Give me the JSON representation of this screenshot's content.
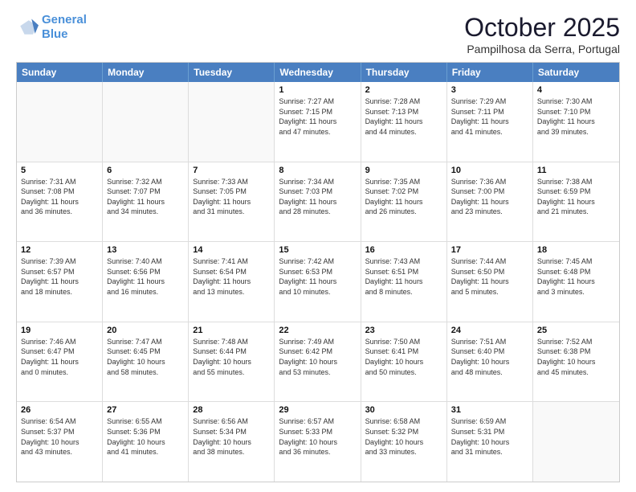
{
  "logo": {
    "line1": "General",
    "line2": "Blue"
  },
  "header": {
    "month": "October 2025",
    "location": "Pampilhosa da Serra, Portugal"
  },
  "weekdays": [
    "Sunday",
    "Monday",
    "Tuesday",
    "Wednesday",
    "Thursday",
    "Friday",
    "Saturday"
  ],
  "rows": [
    [
      {
        "day": "",
        "info": ""
      },
      {
        "day": "",
        "info": ""
      },
      {
        "day": "",
        "info": ""
      },
      {
        "day": "1",
        "info": "Sunrise: 7:27 AM\nSunset: 7:15 PM\nDaylight: 11 hours\nand 47 minutes."
      },
      {
        "day": "2",
        "info": "Sunrise: 7:28 AM\nSunset: 7:13 PM\nDaylight: 11 hours\nand 44 minutes."
      },
      {
        "day": "3",
        "info": "Sunrise: 7:29 AM\nSunset: 7:11 PM\nDaylight: 11 hours\nand 41 minutes."
      },
      {
        "day": "4",
        "info": "Sunrise: 7:30 AM\nSunset: 7:10 PM\nDaylight: 11 hours\nand 39 minutes."
      }
    ],
    [
      {
        "day": "5",
        "info": "Sunrise: 7:31 AM\nSunset: 7:08 PM\nDaylight: 11 hours\nand 36 minutes."
      },
      {
        "day": "6",
        "info": "Sunrise: 7:32 AM\nSunset: 7:07 PM\nDaylight: 11 hours\nand 34 minutes."
      },
      {
        "day": "7",
        "info": "Sunrise: 7:33 AM\nSunset: 7:05 PM\nDaylight: 11 hours\nand 31 minutes."
      },
      {
        "day": "8",
        "info": "Sunrise: 7:34 AM\nSunset: 7:03 PM\nDaylight: 11 hours\nand 28 minutes."
      },
      {
        "day": "9",
        "info": "Sunrise: 7:35 AM\nSunset: 7:02 PM\nDaylight: 11 hours\nand 26 minutes."
      },
      {
        "day": "10",
        "info": "Sunrise: 7:36 AM\nSunset: 7:00 PM\nDaylight: 11 hours\nand 23 minutes."
      },
      {
        "day": "11",
        "info": "Sunrise: 7:38 AM\nSunset: 6:59 PM\nDaylight: 11 hours\nand 21 minutes."
      }
    ],
    [
      {
        "day": "12",
        "info": "Sunrise: 7:39 AM\nSunset: 6:57 PM\nDaylight: 11 hours\nand 18 minutes."
      },
      {
        "day": "13",
        "info": "Sunrise: 7:40 AM\nSunset: 6:56 PM\nDaylight: 11 hours\nand 16 minutes."
      },
      {
        "day": "14",
        "info": "Sunrise: 7:41 AM\nSunset: 6:54 PM\nDaylight: 11 hours\nand 13 minutes."
      },
      {
        "day": "15",
        "info": "Sunrise: 7:42 AM\nSunset: 6:53 PM\nDaylight: 11 hours\nand 10 minutes."
      },
      {
        "day": "16",
        "info": "Sunrise: 7:43 AM\nSunset: 6:51 PM\nDaylight: 11 hours\nand 8 minutes."
      },
      {
        "day": "17",
        "info": "Sunrise: 7:44 AM\nSunset: 6:50 PM\nDaylight: 11 hours\nand 5 minutes."
      },
      {
        "day": "18",
        "info": "Sunrise: 7:45 AM\nSunset: 6:48 PM\nDaylight: 11 hours\nand 3 minutes."
      }
    ],
    [
      {
        "day": "19",
        "info": "Sunrise: 7:46 AM\nSunset: 6:47 PM\nDaylight: 11 hours\nand 0 minutes."
      },
      {
        "day": "20",
        "info": "Sunrise: 7:47 AM\nSunset: 6:45 PM\nDaylight: 10 hours\nand 58 minutes."
      },
      {
        "day": "21",
        "info": "Sunrise: 7:48 AM\nSunset: 6:44 PM\nDaylight: 10 hours\nand 55 minutes."
      },
      {
        "day": "22",
        "info": "Sunrise: 7:49 AM\nSunset: 6:42 PM\nDaylight: 10 hours\nand 53 minutes."
      },
      {
        "day": "23",
        "info": "Sunrise: 7:50 AM\nSunset: 6:41 PM\nDaylight: 10 hours\nand 50 minutes."
      },
      {
        "day": "24",
        "info": "Sunrise: 7:51 AM\nSunset: 6:40 PM\nDaylight: 10 hours\nand 48 minutes."
      },
      {
        "day": "25",
        "info": "Sunrise: 7:52 AM\nSunset: 6:38 PM\nDaylight: 10 hours\nand 45 minutes."
      }
    ],
    [
      {
        "day": "26",
        "info": "Sunrise: 6:54 AM\nSunset: 5:37 PM\nDaylight: 10 hours\nand 43 minutes."
      },
      {
        "day": "27",
        "info": "Sunrise: 6:55 AM\nSunset: 5:36 PM\nDaylight: 10 hours\nand 41 minutes."
      },
      {
        "day": "28",
        "info": "Sunrise: 6:56 AM\nSunset: 5:34 PM\nDaylight: 10 hours\nand 38 minutes."
      },
      {
        "day": "29",
        "info": "Sunrise: 6:57 AM\nSunset: 5:33 PM\nDaylight: 10 hours\nand 36 minutes."
      },
      {
        "day": "30",
        "info": "Sunrise: 6:58 AM\nSunset: 5:32 PM\nDaylight: 10 hours\nand 33 minutes."
      },
      {
        "day": "31",
        "info": "Sunrise: 6:59 AM\nSunset: 5:31 PM\nDaylight: 10 hours\nand 31 minutes."
      },
      {
        "day": "",
        "info": ""
      }
    ]
  ]
}
